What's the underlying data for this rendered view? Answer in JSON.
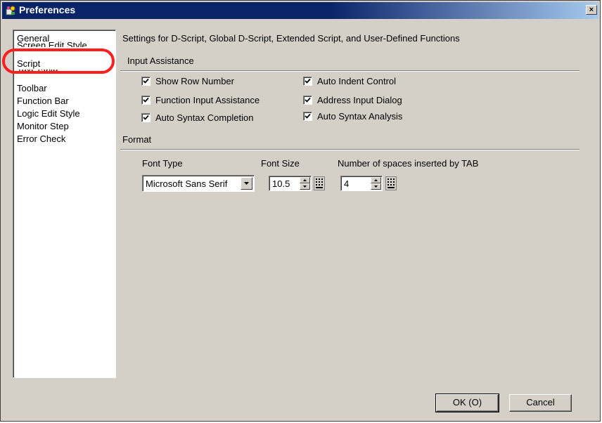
{
  "window": {
    "title": "Preferences",
    "close_symbol": "×"
  },
  "sidebar": {
    "items": [
      {
        "label": "General"
      },
      {
        "label": "Screen Edit Style"
      },
      {
        "label": "Script"
      },
      {
        "label": "Text Table"
      },
      {
        "label": "Toolbar"
      },
      {
        "label": "Function Bar"
      },
      {
        "label": "Logic Edit Style"
      },
      {
        "label": "Monitor Step"
      },
      {
        "label": "Error Check"
      }
    ],
    "selected": "Script",
    "highlight_color": "#ff1f1f"
  },
  "main": {
    "description": "Settings for D-Script, Global D-Script, Extended Script, and User-Defined Functions",
    "input_assistance": {
      "label": "Input Assistance",
      "checkboxes": [
        {
          "label": "Show Row Number",
          "checked": true
        },
        {
          "label": "Auto Indent Control",
          "checked": true
        },
        {
          "label": "Function Input Assistance",
          "checked": true
        },
        {
          "label": "Address Input Dialog",
          "checked": true
        },
        {
          "label": "Auto Syntax Completion",
          "checked": true
        },
        {
          "label": "Auto Syntax Analysis",
          "checked": true
        }
      ]
    },
    "format": {
      "label": "Format",
      "font_type": {
        "label": "Font Type",
        "value": "Microsoft Sans Serif"
      },
      "font_size": {
        "label": "Font Size",
        "value": "10.5"
      },
      "tab_spaces": {
        "label": "Number of spaces inserted by TAB",
        "value": "4"
      }
    }
  },
  "buttons": {
    "ok": "OK (O)",
    "cancel": "Cancel"
  },
  "colors": {
    "title_bar": "#0a246a",
    "dialog_face": "#d4d0c8"
  }
}
